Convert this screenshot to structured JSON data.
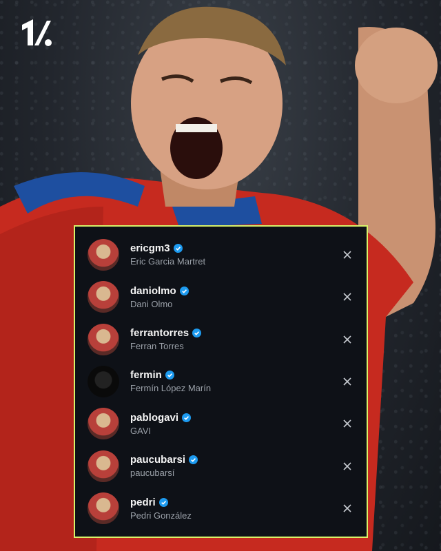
{
  "accounts": [
    {
      "handle": "ericgm3",
      "name": "Eric Garcia Martret",
      "verified": true
    },
    {
      "handle": "daniolmo",
      "name": "Dani Olmo",
      "verified": true
    },
    {
      "handle": "ferrantorres",
      "name": "Ferran Torres",
      "verified": true
    },
    {
      "handle": "fermin",
      "name": "Fermín López Marín",
      "verified": true
    },
    {
      "handle": "pablogavi",
      "name": "GAVI",
      "verified": true
    },
    {
      "handle": "paucubarsi",
      "name": "paucubarsí",
      "verified": true
    },
    {
      "handle": "pedri",
      "name": "Pedri González",
      "verified": true
    }
  ],
  "colors": {
    "panel_border": "#d8f26a",
    "panel_bg": "#0e1117",
    "verified_badge": "#1d9bf0",
    "handle_text": "#f5f5f5",
    "name_text": "#9aa0a8"
  },
  "icons": {
    "brand": "onefootball-logo",
    "verified": "verified-badge-icon",
    "remove": "close-icon"
  }
}
